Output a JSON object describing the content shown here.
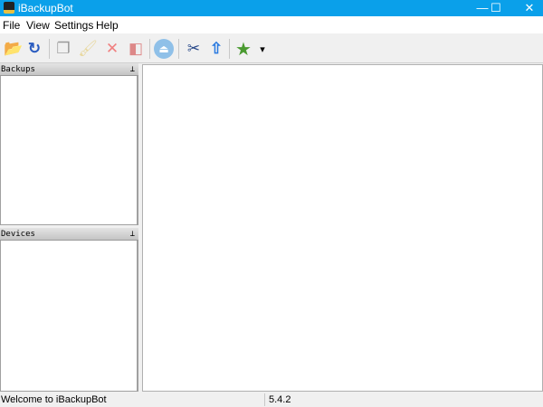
{
  "window": {
    "title": "iBackupBot",
    "minimize": "—",
    "maximize": "☐",
    "close": "✕"
  },
  "menu": [
    "File",
    "View",
    "Settings",
    "Help"
  ],
  "toolbar": {
    "icons": [
      "open-folder",
      "refresh",
      "copy",
      "clean-brush",
      "delete",
      "restore",
      "eject",
      "tools",
      "upload",
      "favorite-star",
      "dropdown"
    ],
    "glyphs": [
      "📂",
      "↻",
      "❐",
      "🖌",
      "✕",
      "◧",
      "⏏",
      "✂",
      "⇧",
      "★",
      "▾"
    ]
  },
  "panels": {
    "backups": "Backups",
    "devices": "Devices",
    "pin": "⊥"
  },
  "status": {
    "message": "Welcome to iBackupBot",
    "version": "5.4.2"
  }
}
